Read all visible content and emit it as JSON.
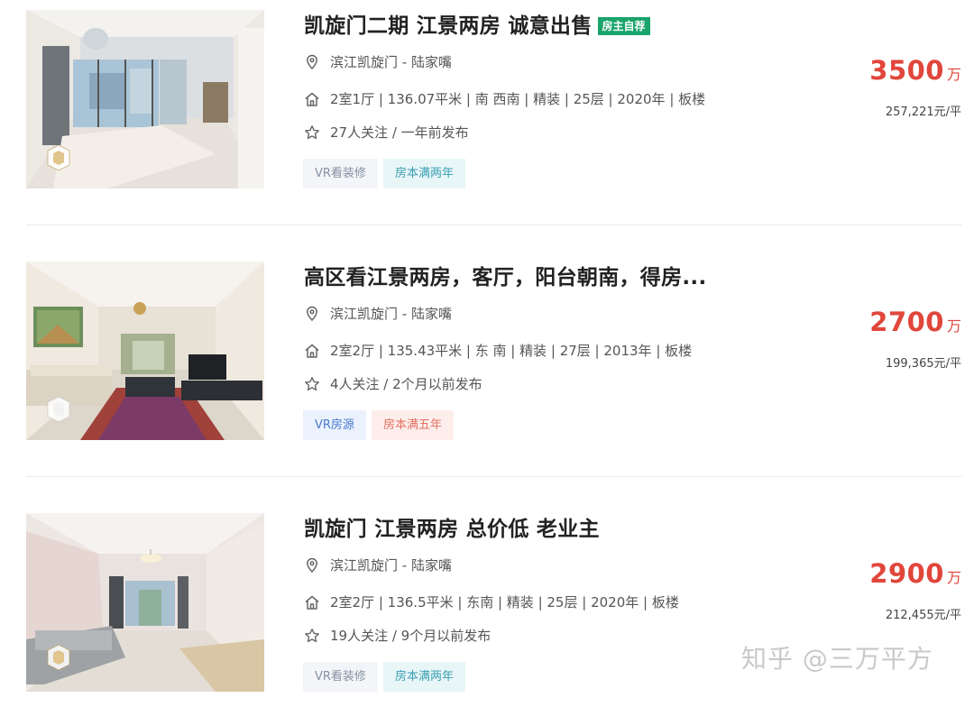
{
  "listings": [
    {
      "title": "凯旋门二期 江景两房 诚意出售",
      "tag_badge": "房主自荐",
      "location": "滨江凯旋门 - 陆家嘴",
      "info": "2室1厅 | 136.07平米 | 南 西南 | 精装 | 25层 | 2020年 | 板楼",
      "follow": "27人关注 / 一年前发布",
      "tags": [
        "VR看装修",
        "房本满两年"
      ],
      "price": "3500",
      "price_unit": "万",
      "unit_price": "257,221元/平"
    },
    {
      "title": "高区看江景两房，客厅，阳台朝南，得房...",
      "tag_badge": "",
      "location": "滨江凯旋门 - 陆家嘴",
      "info": "2室2厅 | 135.43平米 | 东 南 | 精装 | 27层 | 2013年 | 板楼",
      "follow": "4人关注 / 2个月以前发布",
      "tags": [
        "VR房源",
        "房本满五年"
      ],
      "price": "2700",
      "price_unit": "万",
      "unit_price": "199,365元/平"
    },
    {
      "title": "凯旋门 江景两房 总价低 老业主",
      "tag_badge": "",
      "location": "滨江凯旋门 - 陆家嘴",
      "info": "2室2厅 | 136.5平米 | 东南 | 精装 | 25层 | 2020年 | 板楼",
      "follow": "19人关注 / 9个月以前发布",
      "tags": [
        "VR看装修",
        "房本满两年"
      ],
      "price": "2900",
      "price_unit": "万",
      "unit_price": "212,455元/平"
    }
  ],
  "watermark": "知乎 @三万平方",
  "colors": {
    "price": "#e1463b",
    "owner_badge": "#1aa36a"
  },
  "icons": {
    "location": "location-pin-icon",
    "house": "house-icon",
    "follow": "star-icon",
    "vr": "vr-cube-icon"
  }
}
